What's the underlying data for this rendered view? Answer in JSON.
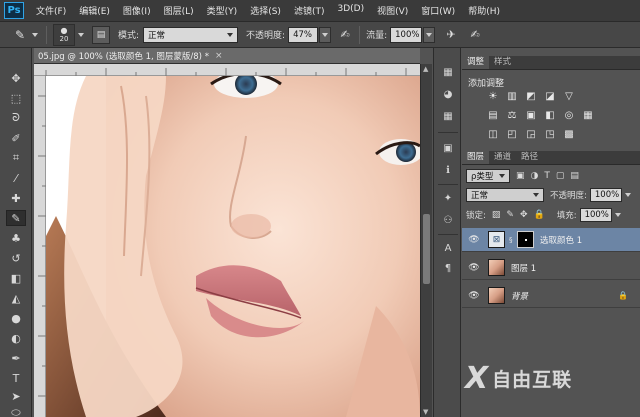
{
  "app": {
    "logo_text": "Ps"
  },
  "menu": [
    "文件(F)",
    "编辑(E)",
    "图像(I)",
    "图层(L)",
    "类型(Y)",
    "选择(S)",
    "滤镜(T)",
    "3D(D)",
    "视图(V)",
    "窗口(W)",
    "帮助(H)"
  ],
  "options": {
    "brush_size": "20",
    "mode_label": "模式:",
    "mode_value": "正常",
    "opacity_label": "不透明度:",
    "opacity_value": "47%",
    "flow_label": "流量:",
    "flow_value": "100%"
  },
  "document": {
    "tab_title": "05.jpg @ 100% (选取颜色 1, 图层蒙版/8) *",
    "close_glyph": "×"
  },
  "adjustments": {
    "tabs": [
      {
        "label": "调整",
        "selected": true
      },
      {
        "label": "样式",
        "selected": false
      }
    ],
    "title": "添加调整",
    "row1": [
      "☀",
      "▥",
      "◩",
      "◪",
      "▽"
    ],
    "row2": [
      "▤",
      "⚖",
      "▣",
      "◧",
      "◎",
      "▦"
    ],
    "row3": [
      "◫",
      "◰",
      "◲",
      "◳",
      "▩"
    ]
  },
  "layers_panel": {
    "tabs": [
      {
        "label": "图层",
        "selected": true
      },
      {
        "label": "通道",
        "selected": false
      },
      {
        "label": "路径",
        "selected": false
      }
    ],
    "filter_label": "ρ类型",
    "blend_mode": "正常",
    "opacity_label": "不透明度:",
    "opacity_value": "100%",
    "lock_label": "锁定:",
    "fill_label": "填充:",
    "fill_value": "100%",
    "layers": [
      {
        "name": "选取颜色 1",
        "type": "adjustment",
        "selected": true,
        "visible": true
      },
      {
        "name": "图层 1",
        "type": "pixel",
        "selected": false,
        "visible": true
      },
      {
        "name": "背景",
        "type": "background",
        "selected": false,
        "visible": true,
        "locked": true
      }
    ]
  },
  "watermark": {
    "mark": "X",
    "text": "自由互联"
  },
  "colors": {
    "selection": "#6c85a5",
    "ps_blue": "#32b3f5",
    "panel_bg": "#535353"
  }
}
